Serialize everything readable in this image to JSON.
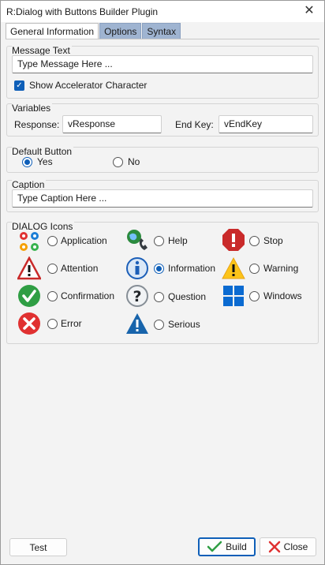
{
  "window": {
    "title": "R:Dialog with Buttons Builder Plugin",
    "close_glyph": "✕"
  },
  "tabs": [
    {
      "label": "General Information",
      "active": true
    },
    {
      "label": "Options",
      "active": false
    },
    {
      "label": "Syntax",
      "active": false
    }
  ],
  "message": {
    "group_label": "Message Text",
    "value": "Type Message Here ...",
    "accelerator_label": "Show Accelerator Character",
    "accelerator_checked": true
  },
  "variables": {
    "group_label": "Variables",
    "response_label": "Response:",
    "response_value": "vResponse",
    "endkey_label": "End Key:",
    "endkey_value": "vEndKey"
  },
  "default_button": {
    "group_label": "Default Button",
    "options": [
      {
        "label": "Yes",
        "selected": true
      },
      {
        "label": "No",
        "selected": false
      }
    ]
  },
  "caption": {
    "group_label": "Caption",
    "value": "Type Caption Here ..."
  },
  "dialog_icons": {
    "group_label": "DIALOG Icons",
    "items": [
      {
        "label": "Application",
        "icon": "application-gears-icon",
        "selected": false
      },
      {
        "label": "Help",
        "icon": "help-globe-phone-icon",
        "selected": false
      },
      {
        "label": "Stop",
        "icon": "stop-octagon-icon",
        "selected": false
      },
      {
        "label": "Attention",
        "icon": "attention-triangle-icon",
        "selected": false
      },
      {
        "label": "Information",
        "icon": "information-icon",
        "selected": true
      },
      {
        "label": "Warning",
        "icon": "warning-triangle-icon",
        "selected": false
      },
      {
        "label": "Confirmation",
        "icon": "confirmation-check-icon",
        "selected": false
      },
      {
        "label": "Question",
        "icon": "question-icon",
        "selected": false
      },
      {
        "label": "Windows",
        "icon": "windows-logo-icon",
        "selected": false
      },
      {
        "label": "Error",
        "icon": "error-x-icon",
        "selected": false
      },
      {
        "label": "Serious",
        "icon": "serious-triangle-icon",
        "selected": false
      }
    ]
  },
  "footer": {
    "test_label": "Test",
    "build_label": "Build",
    "close_label": "Close"
  },
  "colors": {
    "accent": "#0f5fb8",
    "tab_inactive": "#9fb4d1"
  }
}
